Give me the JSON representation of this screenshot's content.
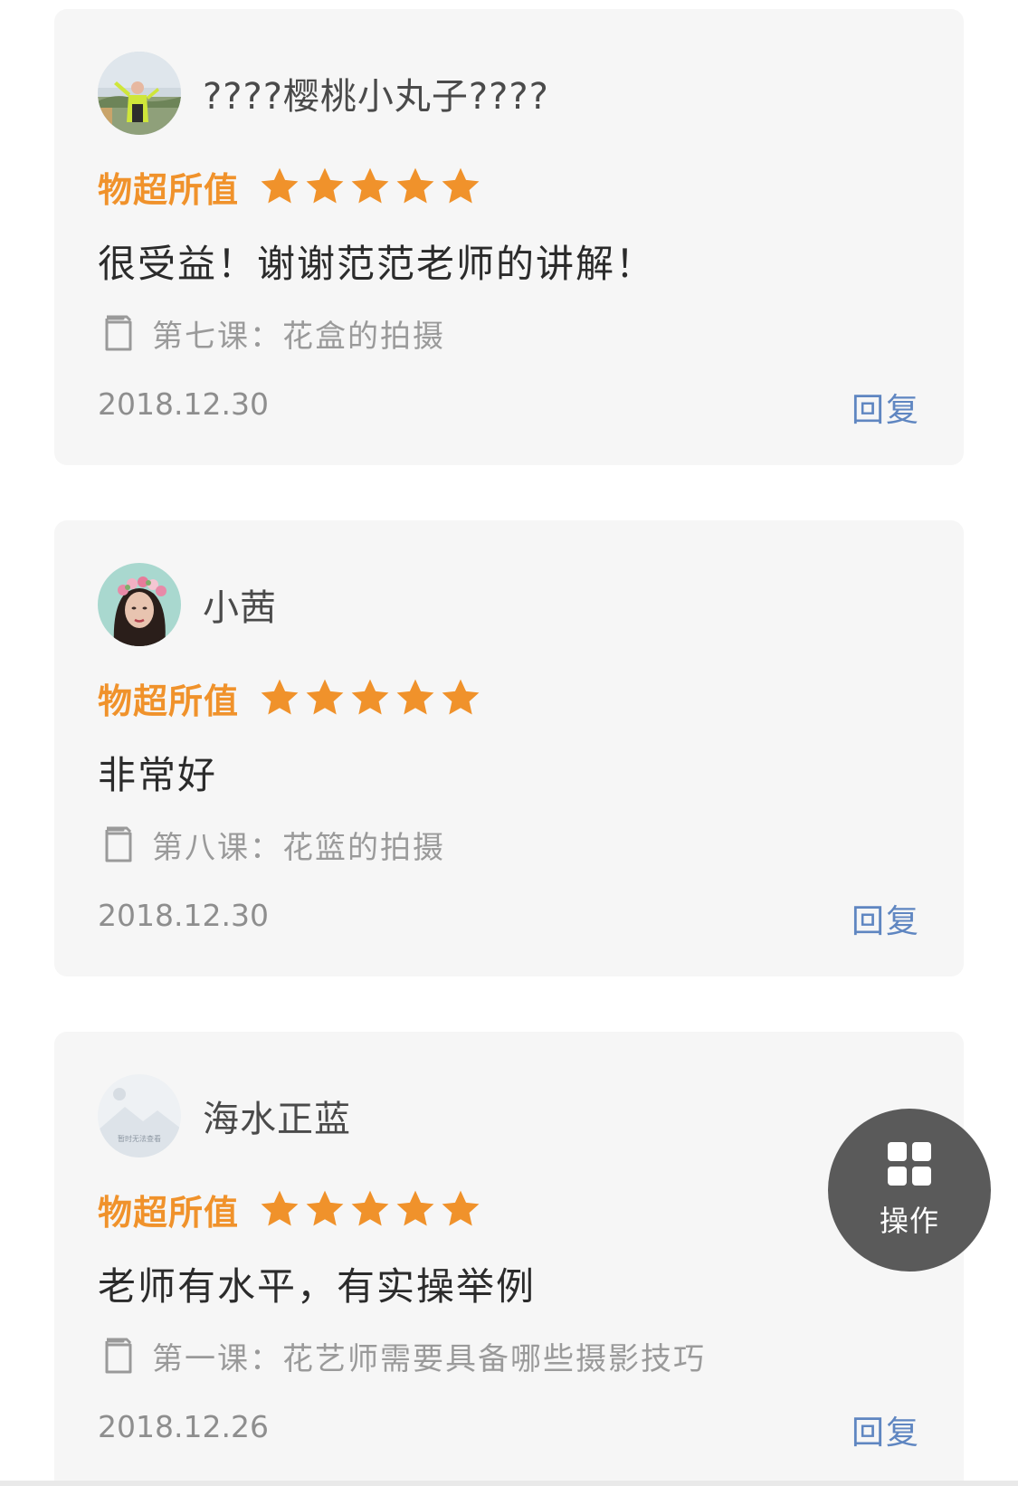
{
  "colors": {
    "accent_orange": "#f0922b",
    "link_blue": "#5f86c1",
    "card_bg": "#f6f6f6",
    "fab_bg": "#5a5a5a"
  },
  "reviews": [
    {
      "username": "????樱桃小丸子????",
      "avatar_icon": "photo-avatar-icon",
      "rating_label": "物超所值",
      "rating": 5,
      "rating_max": 5,
      "comment": "很受益！谢谢范范老师的讲解！",
      "lesson": "第七课：花盒的拍摄",
      "date": "2018.12.30",
      "reply_label": "回复"
    },
    {
      "username": "小茜",
      "avatar_icon": "photo-avatar-icon",
      "rating_label": "物超所值",
      "rating": 5,
      "rating_max": 5,
      "comment": "非常好",
      "lesson": "第八课：花篮的拍摄",
      "date": "2018.12.30",
      "reply_label": "回复"
    },
    {
      "username": "海水正蓝",
      "avatar_icon": "placeholder-avatar-icon",
      "avatar_placeholder_text": "暂时无法查看",
      "rating_label": "物超所值",
      "rating": 5,
      "rating_max": 5,
      "comment": "老师有水平，有实操举例",
      "lesson": "第一课：花艺师需要具备哪些摄影技巧",
      "date": "2018.12.26",
      "reply_label": "回复"
    }
  ],
  "fab": {
    "label": "操作",
    "icon": "grid-icon"
  }
}
